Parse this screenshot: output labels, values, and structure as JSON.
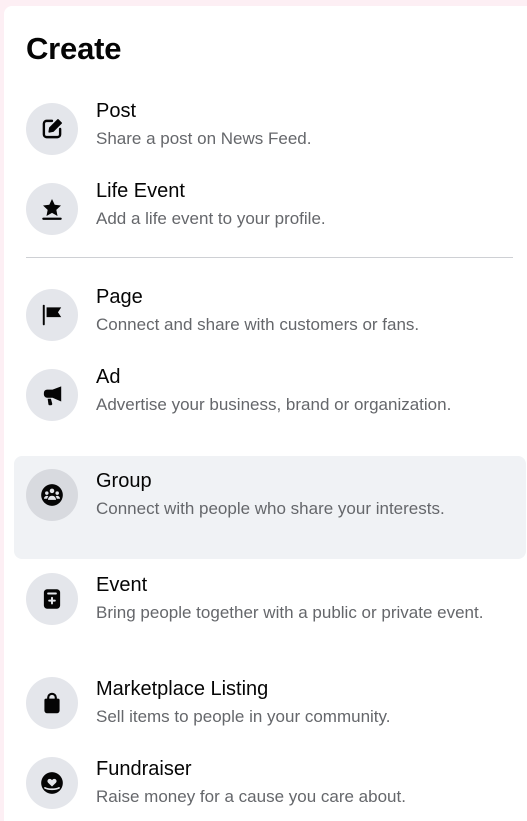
{
  "header": {
    "title": "Create"
  },
  "items": [
    {
      "title": "Post",
      "description": "Share a post on News Feed.",
      "icon": "edit-icon"
    },
    {
      "title": "Life Event",
      "description": "Add a life event to your profile.",
      "icon": "star-icon"
    },
    {
      "title": "Page",
      "description": "Connect and share with customers or fans.",
      "icon": "flag-icon"
    },
    {
      "title": "Ad",
      "description": "Advertise your business, brand or organization.",
      "icon": "megaphone-icon"
    },
    {
      "title": "Group",
      "description": "Connect with people who share your interests.",
      "icon": "group-icon",
      "highlighted": true
    },
    {
      "title": "Event",
      "description": "Bring people together with a public or private event.",
      "icon": "calendar-plus-icon"
    },
    {
      "title": "Marketplace Listing",
      "description": "Sell items to people in your community.",
      "icon": "shopping-bag-icon"
    },
    {
      "title": "Fundraiser",
      "description": "Raise money for a cause you care about.",
      "icon": "heart-hand-icon"
    }
  ],
  "colors": {
    "background": "#fdeff4",
    "panel": "#ffffff",
    "icon_circle": "#e4e6eb",
    "highlight": "#f0f2f5",
    "icon_glyph": "#050505",
    "secondary_text": "#65676b",
    "divider": "#ced0d4"
  }
}
